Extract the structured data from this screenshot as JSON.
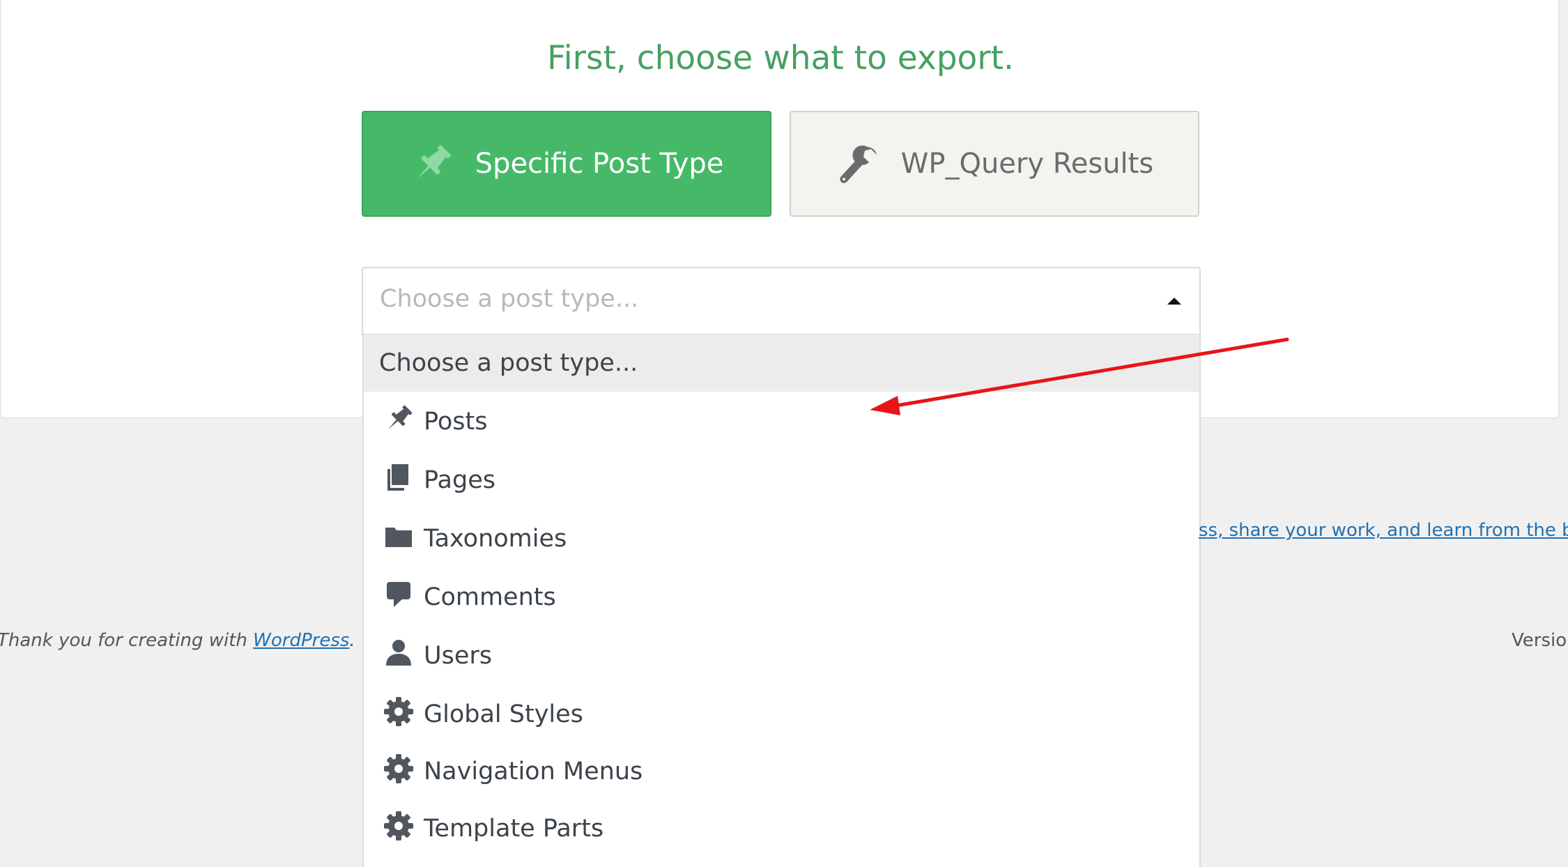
{
  "header": {
    "title": "First, choose what to export."
  },
  "export_types": {
    "specific": {
      "label": "Specific Post Type",
      "icon": "pushpin-icon"
    },
    "wpquery": {
      "label": "WP_Query Results",
      "icon": "wrench-icon"
    }
  },
  "post_type_select": {
    "placeholder": "Choose a post type...",
    "open": true,
    "options": [
      {
        "label": "Choose a post type..."
      },
      {
        "label": "Posts",
        "icon": "pushpin-icon"
      },
      {
        "label": "Pages",
        "icon": "pages-icon"
      },
      {
        "label": "Taxonomies",
        "icon": "folder-icon"
      },
      {
        "label": "Comments",
        "icon": "comment-icon"
      },
      {
        "label": "Users",
        "icon": "user-icon"
      },
      {
        "label": "Global Styles",
        "icon": "gear-icon"
      },
      {
        "label": "Navigation Menus",
        "icon": "gear-icon"
      },
      {
        "label": "Template Parts",
        "icon": "gear-icon"
      }
    ]
  },
  "footer": {
    "community_link": "ss, share your work, and learn from the best.",
    "thanks_prefix": "Thank you for creating with ",
    "thanks_link": "WordPress",
    "thanks_suffix": ".",
    "version": "Version"
  },
  "colors": {
    "accent_green": "#46b969",
    "headline_green": "#46a162",
    "link_blue": "#2271b1",
    "annotation_red": "#e8141a"
  }
}
